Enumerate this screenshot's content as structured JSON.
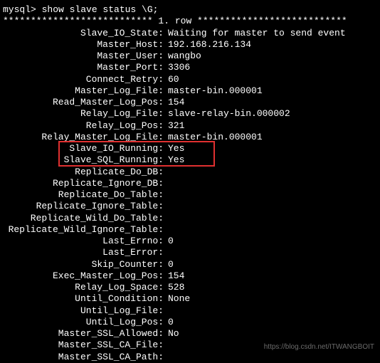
{
  "prompt": "mysql> show slave status \\G;",
  "row_header": "*************************** 1. row ***************************",
  "fields": [
    {
      "label": "Slave_IO_State",
      "value": "Waiting for master to send event"
    },
    {
      "label": "Master_Host",
      "value": "192.168.216.134"
    },
    {
      "label": "Master_User",
      "value": "wangbo"
    },
    {
      "label": "Master_Port",
      "value": "3306"
    },
    {
      "label": "Connect_Retry",
      "value": "60"
    },
    {
      "label": "Master_Log_File",
      "value": "master-bin.000001"
    },
    {
      "label": "Read_Master_Log_Pos",
      "value": "154"
    },
    {
      "label": "Relay_Log_File",
      "value": "slave-relay-bin.000002"
    },
    {
      "label": "Relay_Log_Pos",
      "value": "321"
    },
    {
      "label": "Relay_Master_Log_File",
      "value": "master-bin.000001"
    },
    {
      "label": "Slave_IO_Running",
      "value": "Yes"
    },
    {
      "label": "Slave_SQL_Running",
      "value": "Yes"
    },
    {
      "label": "Replicate_Do_DB",
      "value": ""
    },
    {
      "label": "Replicate_Ignore_DB",
      "value": ""
    },
    {
      "label": "Replicate_Do_Table",
      "value": ""
    },
    {
      "label": "Replicate_Ignore_Table",
      "value": ""
    },
    {
      "label": "Replicate_Wild_Do_Table",
      "value": ""
    },
    {
      "label": "Replicate_Wild_Ignore_Table",
      "value": ""
    },
    {
      "label": "Last_Errno",
      "value": "0"
    },
    {
      "label": "Last_Error",
      "value": ""
    },
    {
      "label": "Skip_Counter",
      "value": "0"
    },
    {
      "label": "Exec_Master_Log_Pos",
      "value": "154"
    },
    {
      "label": "Relay_Log_Space",
      "value": "528"
    },
    {
      "label": "Until_Condition",
      "value": "None"
    },
    {
      "label": "Until_Log_File",
      "value": ""
    },
    {
      "label": "Until_Log_Pos",
      "value": "0"
    },
    {
      "label": "Master_SSL_Allowed",
      "value": "No"
    },
    {
      "label": "Master_SSL_CA_File",
      "value": ""
    },
    {
      "label": "Master_SSL_CA_Path",
      "value": ""
    }
  ],
  "watermark": "https://blog.csdn.net/ITWANGBOIT"
}
